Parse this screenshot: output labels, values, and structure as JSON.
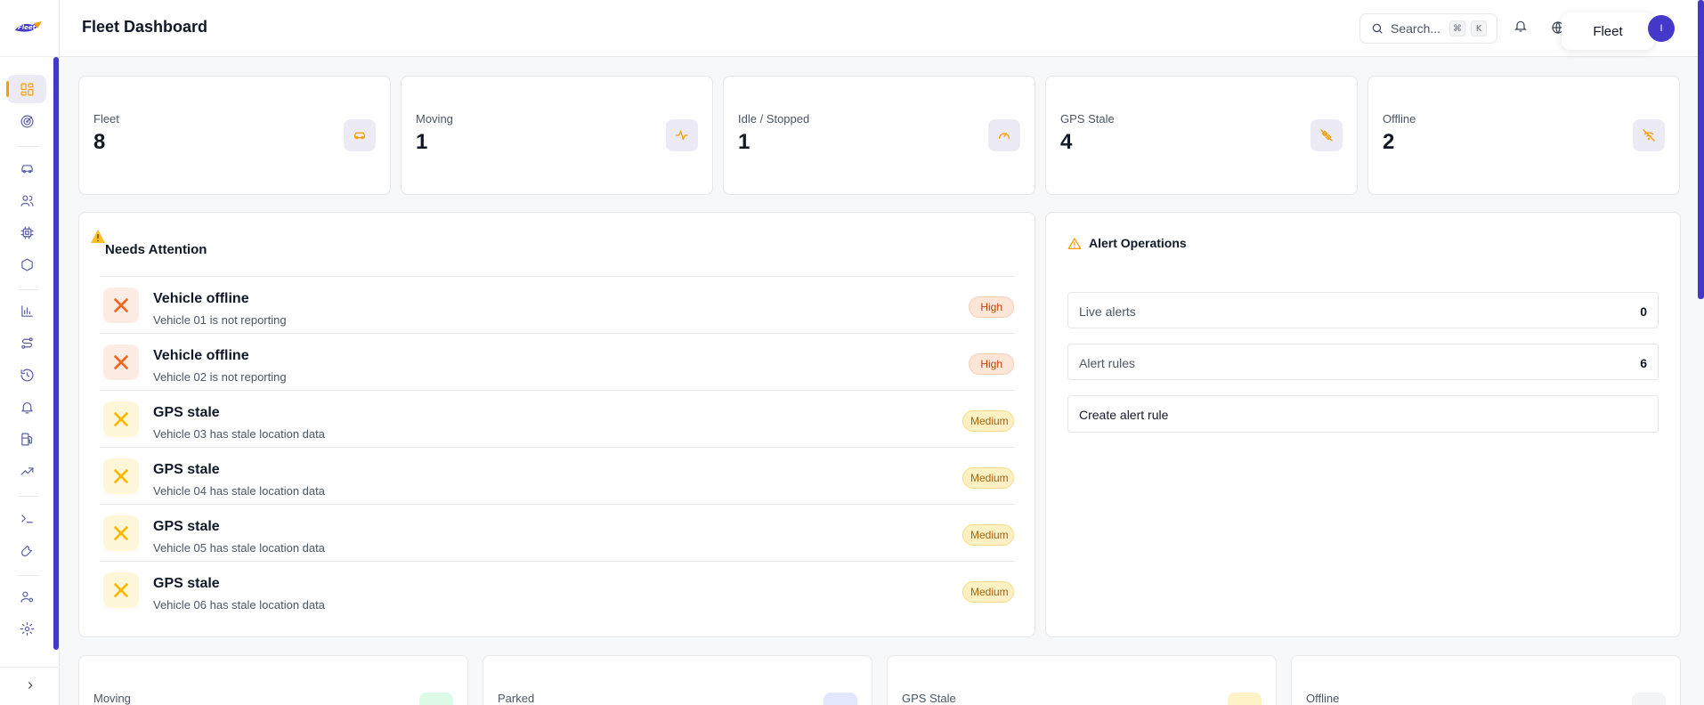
{
  "app": {
    "title": "Fleet Dashboard"
  },
  "header": {
    "search_placeholder": "Search...",
    "shortcut_key1": "⌘",
    "shortcut_key2": "K",
    "fleet_switcher": "Fleet",
    "avatar_initial": "I"
  },
  "sidebar": {
    "logo": "Fleet",
    "items": [
      {
        "name": "dashboard",
        "icon": "grid-icon"
      },
      {
        "name": "live-tracking",
        "icon": "radar-icon"
      },
      {
        "name": "vehicles",
        "icon": "car-icon"
      },
      {
        "name": "drivers",
        "icon": "users-icon"
      },
      {
        "name": "devices",
        "icon": "chip-icon"
      },
      {
        "name": "geofences",
        "icon": "hexagon-icon"
      },
      {
        "name": "reports",
        "icon": "bar-chart-icon"
      },
      {
        "name": "routes",
        "icon": "route-icon"
      },
      {
        "name": "history",
        "icon": "history-icon"
      },
      {
        "name": "alerts",
        "icon": "bell-icon"
      },
      {
        "name": "fuel",
        "icon": "fuel-icon"
      },
      {
        "name": "analytics",
        "icon": "trending-icon"
      },
      {
        "name": "console",
        "icon": "terminal-icon"
      },
      {
        "name": "maintenance",
        "icon": "wrench-icon"
      },
      {
        "name": "user-settings",
        "icon": "user-cog-icon"
      },
      {
        "name": "settings",
        "icon": "gear-icon"
      }
    ]
  },
  "stats": [
    {
      "label": "Fleet",
      "value": "8",
      "icon": "car-icon"
    },
    {
      "label": "Moving",
      "value": "1",
      "icon": "activity-icon"
    },
    {
      "label": "Idle / Stopped",
      "value": "1",
      "icon": "gauge-icon"
    },
    {
      "label": "GPS Stale",
      "value": "4",
      "icon": "satellite-off-icon"
    },
    {
      "label": "Offline",
      "value": "2",
      "icon": "wifi-off-icon"
    }
  ],
  "attention": {
    "title": "Needs Attention",
    "items": [
      {
        "title": "Vehicle offline",
        "subtitle": "Vehicle 01 is not reporting",
        "severity": "High"
      },
      {
        "title": "Vehicle offline",
        "subtitle": "Vehicle 02 is not reporting",
        "severity": "High"
      },
      {
        "title": "GPS stale",
        "subtitle": "Vehicle 03 has stale location data",
        "severity": "Medium"
      },
      {
        "title": "GPS stale",
        "subtitle": "Vehicle 04 has stale location data",
        "severity": "Medium"
      },
      {
        "title": "GPS stale",
        "subtitle": "Vehicle 05 has stale location data",
        "severity": "Medium"
      },
      {
        "title": "GPS stale",
        "subtitle": "Vehicle 06 has stale location data",
        "severity": "Medium"
      }
    ]
  },
  "alert_ops": {
    "title": "Alert Operations",
    "live_alerts_label": "Live alerts",
    "live_alerts_value": "0",
    "alert_rules_label": "Alert rules",
    "alert_rules_value": "6",
    "create_label": "Create alert rule"
  },
  "bottom_cards": [
    {
      "label": "Moving",
      "color": "#dcfce7"
    },
    {
      "label": "Parked",
      "color": "#e0e7ff"
    },
    {
      "label": "GPS Stale",
      "color": "#fef3c7"
    },
    {
      "label": "Offline",
      "color": "#f3f4f6"
    }
  ],
  "colors": {
    "accent": "#f59e0b",
    "brand": "#4338ca",
    "high": "#f26522",
    "medium": "#f5b800"
  }
}
